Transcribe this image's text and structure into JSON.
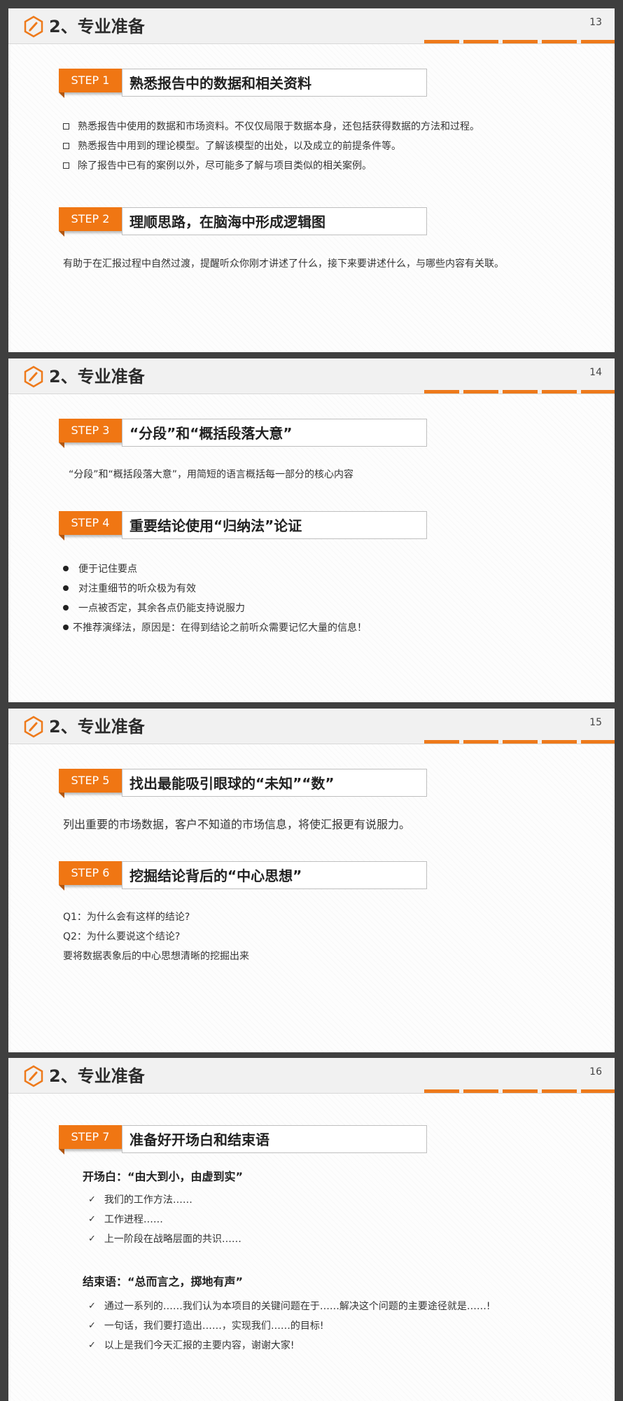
{
  "slides": [
    {
      "title": "2、专业准备",
      "page": "13",
      "steps": [
        {
          "label": "STEP 1",
          "title": "熟悉报告中的数据和相关资料"
        },
        {
          "label": "STEP 2",
          "title": "理顺思路，在脑海中形成逻辑图"
        }
      ],
      "step1_items": [
        "熟悉报告中使用的数据和市场资料。不仅仅局限于数据本身，还包括获得数据的方法和过程。",
        "熟悉报告中用到的理论模型。了解该模型的出处，以及成立的前提条件等。",
        "除了报告中已有的案例以外，尽可能多了解与项目类似的相关案例。"
      ],
      "step2_text": "有助于在汇报过程中自然过渡，提醒听众你刚才讲述了什么，接下来要讲述什么，与哪些内容有关联。"
    },
    {
      "title": "2、专业准备",
      "page": "14",
      "steps": [
        {
          "label": "STEP 3",
          "title": "“分段”和“概括段落大意”"
        },
        {
          "label": "STEP 4",
          "title": "重要结论使用“归纳法”论证"
        }
      ],
      "step3_text": "“分段”和“概括段落大意”，用简短的语言概括每一部分的核心内容",
      "step4_items": [
        "便于记住要点",
        "对注重细节的听众极为有效",
        "一点被否定，其余各点仍能支持说服力",
        "不推荐演绎法，原因是：在得到结论之前听众需要记忆大量的信息！"
      ]
    },
    {
      "title": "2、专业准备",
      "page": "15",
      "steps": [
        {
          "label": "STEP 5",
          "title": "找出最能吸引眼球的“未知”“数”"
        },
        {
          "label": "STEP 6",
          "title": "挖掘结论背后的“中心思想”"
        }
      ],
      "step5_text": "列出重要的市场数据，客户不知道的市场信息，将使汇报更有说服力。",
      "step6_lines": [
        "Q1：为什么会有这样的结论?",
        "Q2：为什么要说这个结论?",
        "要将数据表象后的中心思想清晰的挖掘出来"
      ]
    },
    {
      "title": "2、专业准备",
      "page": "16",
      "steps": [
        {
          "label": "STEP 7",
          "title": "准备好开场白和结束语"
        }
      ],
      "opening_head": "开场白：“由大到小，由虚到实”",
      "opening_items": [
        "我们的工作方法……",
        "工作进程……",
        "上一阶段在战略层面的共识……"
      ],
      "closing_head": "结束语：“总而言之，掷地有声”",
      "closing_items": [
        "通过一系列的……我们认为本项目的关键问题在于……解决这个问题的主要途径就是……!",
        "一句话，我们要打造出……，实现我们……的目标!",
        "以上是我们今天汇报的主要内容，谢谢大家!"
      ]
    }
  ],
  "colors": {
    "accent": "#f07613",
    "bar": "#ee7a1b",
    "tag_shadow": "#b2560f"
  },
  "icons": {
    "logo": "pen-hexagon-icon",
    "bullet_square": "square-bullet-icon",
    "bullet_dot": "dot-bullet-icon",
    "check": "check-icon"
  }
}
